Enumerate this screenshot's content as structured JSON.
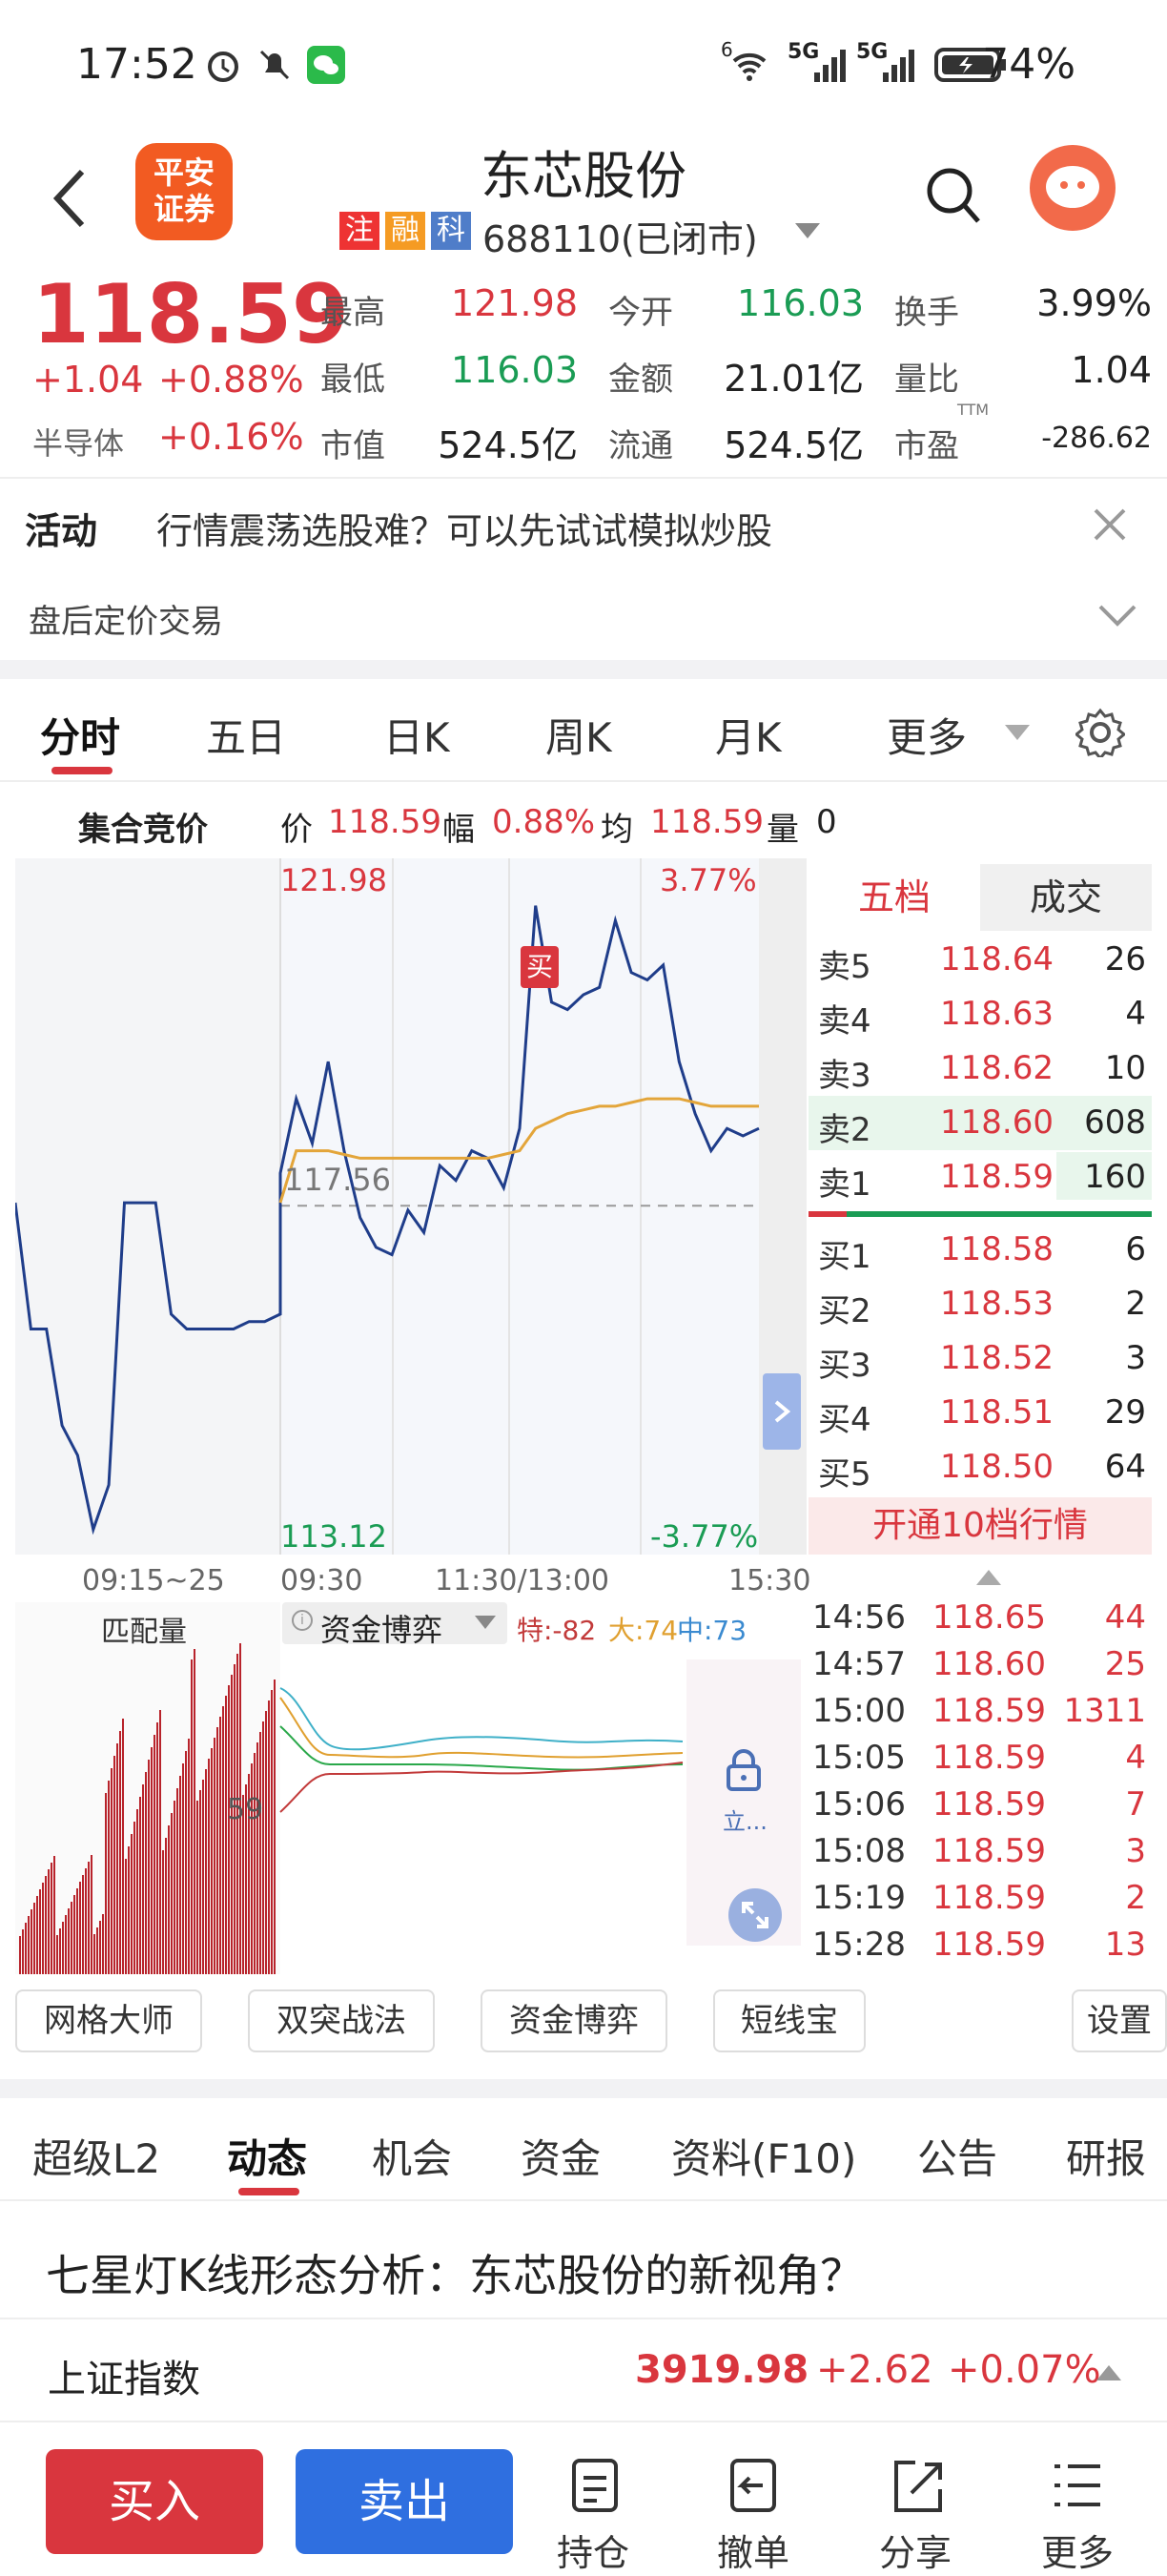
{
  "status_bar": {
    "time": "17:52",
    "battery": "74%",
    "net1": "5G",
    "net2": "5G",
    "wifi_badge": "6"
  },
  "header": {
    "title": "东芯股份",
    "tag_zhu": "注",
    "tag_rong": "融",
    "tag_ke": "科",
    "code_status": "688110(已闭市)",
    "broker_logo": "平安\n证券",
    "colors": {
      "accent_red": "#d9363e",
      "green": "#1a9c54",
      "brand_orange": "#f25b22",
      "blue": "#2f6fe0"
    }
  },
  "quote": {
    "price": "118.59",
    "change": "+1.04",
    "change_pct": "+0.88%",
    "sector": "半导体",
    "sector_pct": "+0.16%",
    "high_label": "最高",
    "high": "121.98",
    "open_label": "今开",
    "open": "116.03",
    "turnover_label": "换手",
    "turnover": "3.99%",
    "low_label": "最低",
    "low": "116.03",
    "amount_label": "金额",
    "amount": "21.01亿",
    "vol_ratio_label": "量比",
    "vol_ratio": "1.04",
    "mcap_label": "市值",
    "mcap": "524.5亿",
    "float_label": "流通",
    "float": "524.5亿",
    "pe_label": "市盈",
    "pe_sup": "TTM",
    "pe": "-286.62"
  },
  "activity": {
    "label": "活动",
    "text": "行情震荡选股难？可以先试试模拟炒股"
  },
  "after_hours": {
    "label": "盘后定价交易"
  },
  "chart_tabs": [
    "分时",
    "五日",
    "日K",
    "周K",
    "月K",
    "更多"
  ],
  "info_bar": {
    "auction": "集合竞价",
    "price_label": "价",
    "price": "118.59",
    "amp_label": "幅",
    "amp": "0.88%",
    "avg_label": "均",
    "avg": "118.59",
    "vol_label": "量",
    "vol": "0"
  },
  "chart_labels": {
    "top_price": "121.98",
    "top_pct": "3.77%",
    "bottom_price": "113.12",
    "bottom_pct": "-3.77%",
    "mid_price": "117.56",
    "buy_marker": "买"
  },
  "chart_data": {
    "type": "line",
    "title": "",
    "x_ticks": [
      "09:15~25",
      "09:30",
      "11:30/13:00",
      "15:30"
    ],
    "ylim": [
      113.12,
      121.98
    ],
    "reference": 117.56,
    "series": [
      {
        "values": [
          117.6,
          115.9,
          115.9,
          114.6,
          114.2,
          113.2,
          113.8,
          117.6,
          117.6,
          117.6,
          116.1,
          115.9,
          115.9,
          115.9,
          115.9,
          116.0,
          116.0,
          116.1,
          118.0,
          119.0,
          118.4,
          119.5,
          118.3,
          117.4,
          117.0,
          116.9,
          117.5,
          117.2,
          118.1,
          117.9,
          118.3,
          118.2,
          117.8,
          118.6,
          121.6,
          120.3,
          120.2,
          120.4,
          120.5,
          121.4,
          120.7,
          120.6,
          120.8,
          119.5,
          118.8,
          118.3,
          118.6,
          118.5,
          118.6
        ]
      },
      {
        "values": [
          null,
          null,
          null,
          null,
          null,
          null,
          null,
          null,
          null,
          null,
          null,
          null,
          null,
          null,
          null,
          null,
          null,
          null,
          117.6,
          118.3,
          118.3,
          118.3,
          118.25,
          118.2,
          118.2,
          118.2,
          118.2,
          118.2,
          118.2,
          118.2,
          118.2,
          118.2,
          118.25,
          118.3,
          118.6,
          118.7,
          118.8,
          118.85,
          118.9,
          118.9,
          118.95,
          119.0,
          119.0,
          119.0,
          118.95,
          118.9,
          118.9,
          118.9,
          118.9
        ]
      }
    ]
  },
  "orderbook": {
    "tabs": [
      "五档",
      "成交"
    ],
    "asks": [
      [
        "卖5",
        "118.64",
        "26"
      ],
      [
        "卖4",
        "118.63",
        "4"
      ],
      [
        "卖3",
        "118.62",
        "10"
      ],
      [
        "卖2",
        "118.60",
        "608"
      ],
      [
        "卖1",
        "118.59",
        "160"
      ]
    ],
    "bids": [
      [
        "买1",
        "118.58",
        "6"
      ],
      [
        "买2",
        "118.53",
        "2"
      ],
      [
        "买3",
        "118.52",
        "3"
      ],
      [
        "买4",
        "118.51",
        "29"
      ],
      [
        "买5",
        "118.50",
        "64"
      ]
    ],
    "promo": "开通10档行情"
  },
  "indicator": {
    "left_label": "匹配量",
    "name": "资金博弈",
    "te": "特:-82",
    "da": "大:74",
    "zhong": "中:73",
    "mid_value": "59",
    "lock_label": "立..."
  },
  "trades": [
    [
      "14:56",
      "118.65",
      "44"
    ],
    [
      "14:57",
      "118.60",
      "25"
    ],
    [
      "15:00",
      "118.59",
      "1311"
    ],
    [
      "15:05",
      "118.59",
      "4"
    ],
    [
      "15:06",
      "118.59",
      "7"
    ],
    [
      "15:08",
      "118.59",
      "3"
    ],
    [
      "15:19",
      "118.59",
      "2"
    ],
    [
      "15:28",
      "118.59",
      "13"
    ]
  ],
  "tools": [
    "网格大师",
    "双突战法",
    "资金博弈",
    "短线宝",
    "设置"
  ],
  "sections": [
    "超级L2",
    "动态",
    "机会",
    "资金",
    "资料(F10)",
    "公告",
    "研报"
  ],
  "article": {
    "title": "七星灯K线形态分析：东芯股份的新视角？"
  },
  "index_bar": {
    "name": "上证指数",
    "value": "3919.98",
    "change": "+2.62",
    "pct": "+0.07%"
  },
  "bottom_bar": {
    "buy": "买入",
    "sell": "卖出",
    "hold": "持仓",
    "cancel": "撤单",
    "share": "分享",
    "more": "更多"
  }
}
